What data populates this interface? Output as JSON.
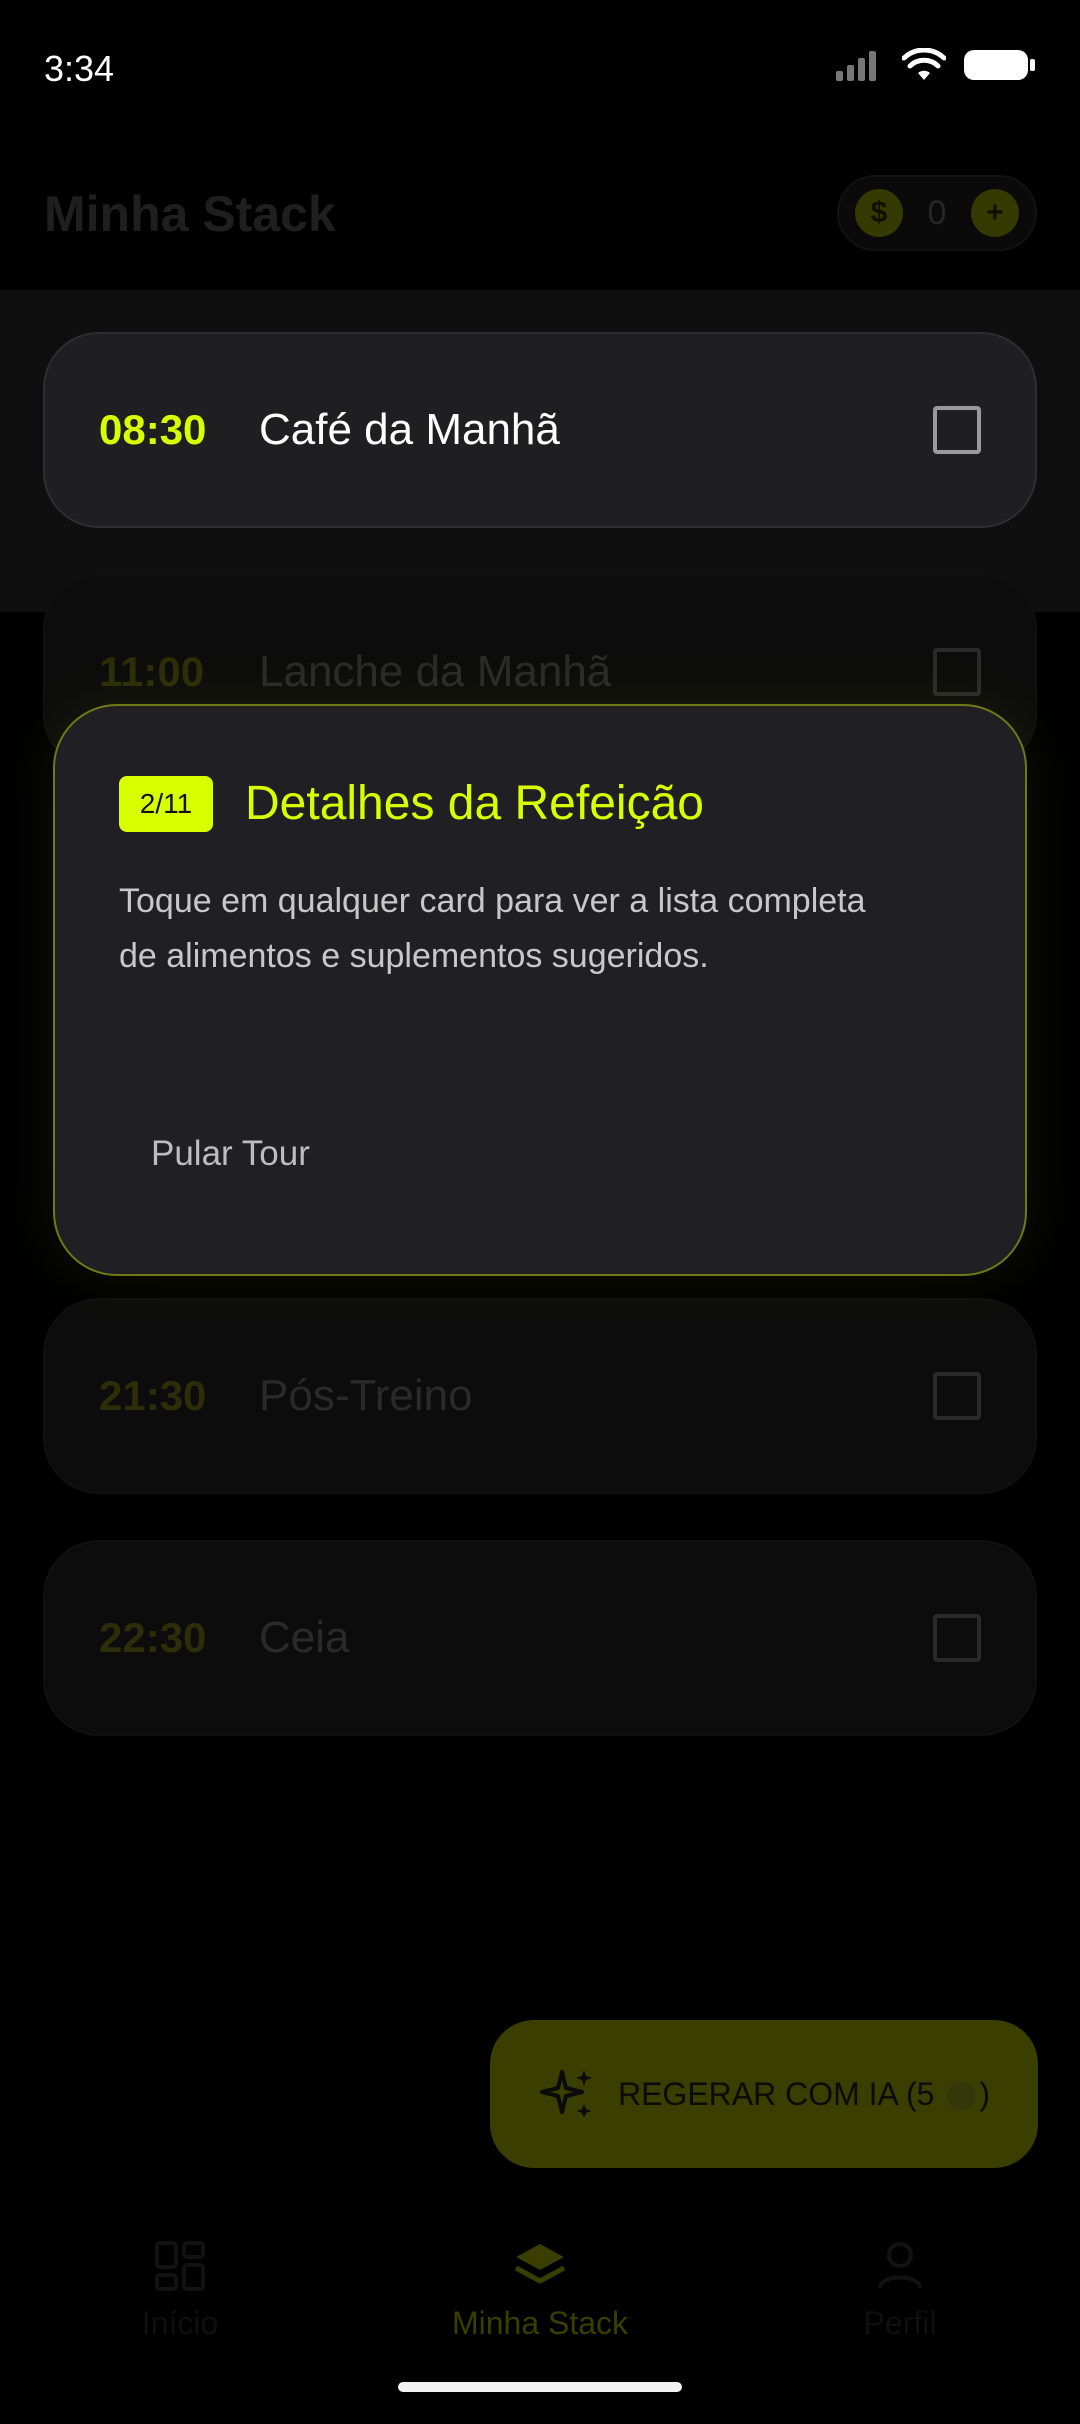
{
  "status_bar": {
    "time": "3:34"
  },
  "header": {
    "title": "Minha Stack",
    "coins": "0"
  },
  "meals": [
    {
      "time": "08:30",
      "label": "Café da Manhã"
    },
    {
      "time": "11:00",
      "label": "Lanche da Manhã"
    },
    {
      "time": "21:30",
      "label": "Pós-Treino"
    },
    {
      "time": "22:30",
      "label": "Ceia"
    }
  ],
  "tour": {
    "step": "2/11",
    "title": "Detalhes da Refeição",
    "body": "Toque em qualquer card para ver a lista completa de alimentos e suplementos sugeridos.",
    "skip_label": "Pular Tour"
  },
  "regenerate": {
    "label_prefix": "REGERAR COM IA (5",
    "label_suffix": ")"
  },
  "nav": {
    "home": "Início",
    "stack": "Minha Stack",
    "profile": "Perfil"
  },
  "colors": {
    "accent": "#d8ff00",
    "card": "#1f1f21",
    "background": "#000000"
  }
}
